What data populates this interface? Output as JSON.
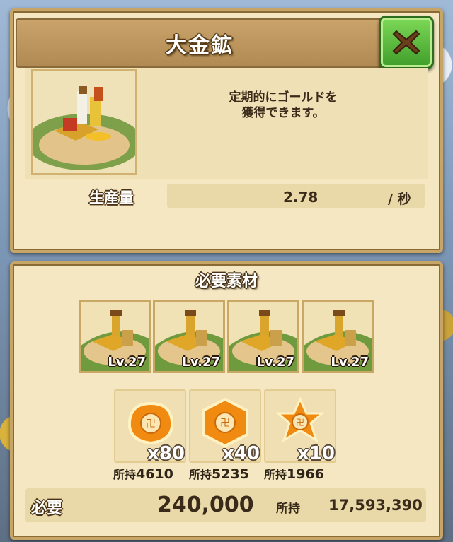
{
  "dialog": {
    "title": "大金鉱",
    "close_icon": "close-x-icon",
    "description": "定期的にゴールドを\n獲得できます。",
    "building_icon": "gold-mine-building-icon"
  },
  "production": {
    "label": "生産量",
    "value": "2.78",
    "unit": "/ 秒"
  },
  "materials": {
    "title": "必要素材",
    "buildings": [
      {
        "level": "Lv.27",
        "icon": "gold-mine-building-icon"
      },
      {
        "level": "Lv.27",
        "icon": "gold-mine-building-icon"
      },
      {
        "level": "Lv.27",
        "icon": "gold-mine-building-icon"
      },
      {
        "level": "Lv.27",
        "icon": "gold-mine-building-icon"
      }
    ],
    "items": [
      {
        "icon": "orange-blob-gem-icon",
        "qty": "x80",
        "owned_label": "所持",
        "owned_value": "4610"
      },
      {
        "icon": "orange-hexagon-gem-icon",
        "qty": "x40",
        "owned_label": "所持",
        "owned_value": "5235"
      },
      {
        "icon": "orange-star-gem-icon",
        "qty": "x10",
        "owned_label": "所持",
        "owned_value": "1966"
      }
    ]
  },
  "cost": {
    "label": "必要",
    "value": "240,000",
    "owned_label": "所持",
    "owned_value": "17,593,390"
  },
  "colors": {
    "panel_bg": "#f4e7c2",
    "title_bar": "#b08a52",
    "close_green": "#3f9d2b",
    "gem_orange": "#f08a10"
  }
}
